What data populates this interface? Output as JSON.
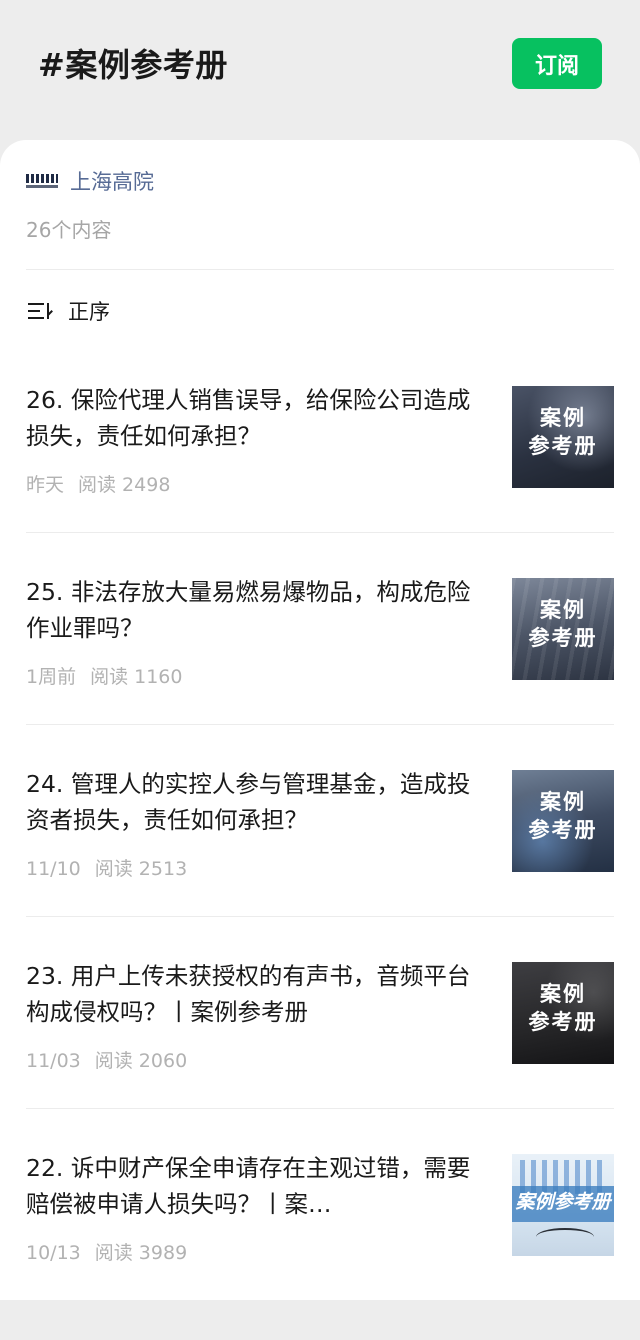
{
  "header": {
    "title": "#案例参考册",
    "subscribe_label": "订阅"
  },
  "account": {
    "name": "上海高院",
    "content_count": "26个内容"
  },
  "sort": {
    "label": "正序"
  },
  "articles": [
    {
      "title": "26. 保险代理人销售误导，给保险公司造成损失，责任如何承担？",
      "date": "昨天",
      "reads": "阅读 2498",
      "thumb_line1": "案例",
      "thumb_line2": "参考册"
    },
    {
      "title": "25. 非法存放大量易燃易爆物品，构成危险作业罪吗？",
      "date": "1周前",
      "reads": "阅读 1160",
      "thumb_line1": "案例",
      "thumb_line2": "参考册"
    },
    {
      "title": "24. 管理人的实控人参与管理基金，造成投资者损失，责任如何承担？",
      "date": "11/10",
      "reads": "阅读 2513",
      "thumb_line1": "案例",
      "thumb_line2": "参考册"
    },
    {
      "title": "23. 用户上传未获授权的有声书，音频平台构成侵权吗？丨案例参考册",
      "date": "11/03",
      "reads": "阅读 2060",
      "thumb_line1": "案例",
      "thumb_line2": "参考册"
    },
    {
      "title": "22. 诉中财产保全申请存在主观过错，需要赔偿被申请人损失吗？丨案…",
      "date": "10/13",
      "reads": "阅读 3989",
      "thumb_line1": "案例参考册",
      "thumb_line2": ""
    }
  ]
}
